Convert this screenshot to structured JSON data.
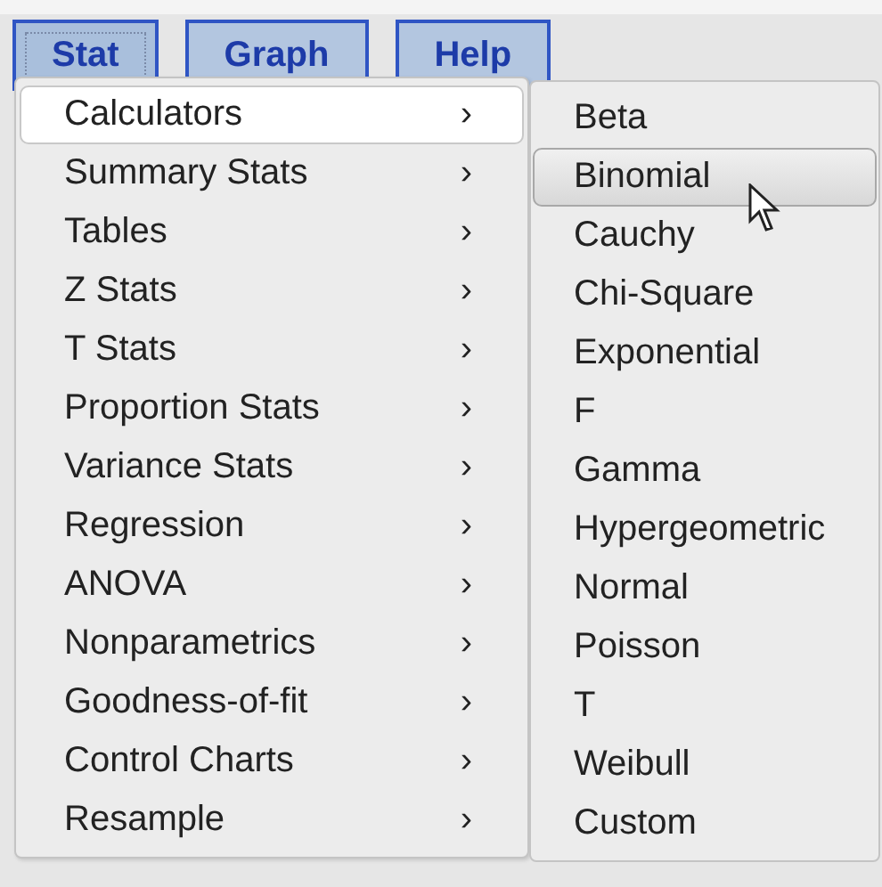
{
  "menubar": [
    {
      "label": "Stat",
      "selected": true
    },
    {
      "label": "Graph",
      "selected": false
    },
    {
      "label": "Help",
      "selected": false
    }
  ],
  "menu": [
    {
      "label": "Calculators",
      "arrow": "›",
      "selected": true
    },
    {
      "label": "Summary Stats",
      "arrow": "›",
      "selected": false
    },
    {
      "label": "Tables",
      "arrow": "›",
      "selected": false
    },
    {
      "label": "Z Stats",
      "arrow": "›",
      "selected": false
    },
    {
      "label": "T Stats",
      "arrow": "›",
      "selected": false
    },
    {
      "label": "Proportion Stats",
      "arrow": "›",
      "selected": false
    },
    {
      "label": "Variance Stats",
      "arrow": "›",
      "selected": false
    },
    {
      "label": "Regression",
      "arrow": "›",
      "selected": false
    },
    {
      "label": "ANOVA",
      "arrow": "›",
      "selected": false
    },
    {
      "label": "Nonparametrics",
      "arrow": "›",
      "selected": false
    },
    {
      "label": "Goodness-of-fit",
      "arrow": "›",
      "selected": false
    },
    {
      "label": "Control Charts",
      "arrow": "›",
      "selected": false
    },
    {
      "label": "Resample",
      "arrow": "›",
      "selected": false
    }
  ],
  "submenu": [
    {
      "label": "Beta",
      "selected": false
    },
    {
      "label": "Binomial",
      "selected": true
    },
    {
      "label": "Cauchy",
      "selected": false
    },
    {
      "label": "Chi-Square",
      "selected": false
    },
    {
      "label": "Exponential",
      "selected": false
    },
    {
      "label": "F",
      "selected": false
    },
    {
      "label": "Gamma",
      "selected": false
    },
    {
      "label": "Hypergeometric",
      "selected": false
    },
    {
      "label": "Normal",
      "selected": false
    },
    {
      "label": "Poisson",
      "selected": false
    },
    {
      "label": "T",
      "selected": false
    },
    {
      "label": "Weibull",
      "selected": false
    },
    {
      "label": "Custom",
      "selected": false
    }
  ]
}
